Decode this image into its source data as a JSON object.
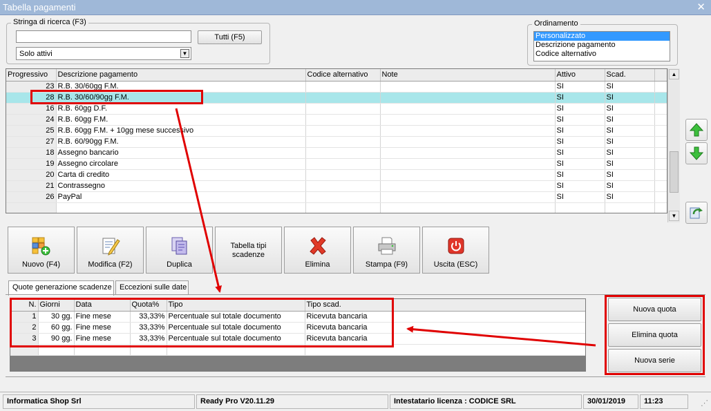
{
  "window": {
    "title": "Tabella pagamenti",
    "close_glyph": "✕"
  },
  "search": {
    "group_label": "Stringa di ricerca (F3)",
    "value": "",
    "all_button": "Tutti (F5)",
    "filter_value": "Solo attivi"
  },
  "ordering": {
    "group_label": "Ordinamento",
    "options": [
      "Personalizzato",
      "Descrizione pagamento",
      "Codice alternativo"
    ],
    "selected_index": 0
  },
  "payments_grid": {
    "columns": [
      "Progressivo",
      "Descrizione pagamento",
      "Codice alternativo",
      "Note",
      "Attivo",
      "Scad."
    ],
    "rows": [
      {
        "progressivo": "23",
        "descrizione": "R.B. 30/60gg F.M.",
        "codice": "",
        "note": "",
        "attivo": "SI",
        "scad": "SI",
        "selected": false
      },
      {
        "progressivo": "28",
        "descrizione": "R.B. 30/60/90gg F.M.",
        "codice": "",
        "note": "",
        "attivo": "SI",
        "scad": "SI",
        "selected": true
      },
      {
        "progressivo": "16",
        "descrizione": "R.B. 60gg D.F.",
        "codice": "",
        "note": "",
        "attivo": "SI",
        "scad": "SI",
        "selected": false
      },
      {
        "progressivo": "24",
        "descrizione": "R.B. 60gg F.M.",
        "codice": "",
        "note": "",
        "attivo": "SI",
        "scad": "SI",
        "selected": false
      },
      {
        "progressivo": "25",
        "descrizione": "R.B. 60gg F.M. + 10gg mese successivo",
        "codice": "",
        "note": "",
        "attivo": "SI",
        "scad": "SI",
        "selected": false
      },
      {
        "progressivo": "27",
        "descrizione": "R.B. 60/90gg F.M.",
        "codice": "",
        "note": "",
        "attivo": "SI",
        "scad": "SI",
        "selected": false
      },
      {
        "progressivo": "18",
        "descrizione": "Assegno bancario",
        "codice": "",
        "note": "",
        "attivo": "SI",
        "scad": "SI",
        "selected": false
      },
      {
        "progressivo": "19",
        "descrizione": "Assegno circolare",
        "codice": "",
        "note": "",
        "attivo": "SI",
        "scad": "SI",
        "selected": false
      },
      {
        "progressivo": "20",
        "descrizione": "Carta di credito",
        "codice": "",
        "note": "",
        "attivo": "SI",
        "scad": "SI",
        "selected": false
      },
      {
        "progressivo": "21",
        "descrizione": "Contrassegno",
        "codice": "",
        "note": "",
        "attivo": "SI",
        "scad": "SI",
        "selected": false
      },
      {
        "progressivo": "26",
        "descrizione": "PayPal",
        "codice": "",
        "note": "",
        "attivo": "SI",
        "scad": "SI",
        "selected": false
      }
    ]
  },
  "toolbar": {
    "new": "Nuovo (F4)",
    "edit": "Modifica (F2)",
    "duplicate": "Duplica",
    "types_line1": "Tabella tipi",
    "types_line2": "scadenze",
    "delete": "Elimina",
    "print": "Stampa (F9)",
    "exit": "Uscita (ESC)"
  },
  "tabs": [
    "Quote generazione scadenze",
    "Eccezioni sulle date"
  ],
  "quotes_grid": {
    "columns": [
      "N.",
      "Giorni",
      "Data",
      "Quota%",
      "Tipo",
      "Tipo scad."
    ],
    "rows": [
      {
        "n": "1",
        "giorni": "30 gg.",
        "data": "Fine mese",
        "quota": "33,33%",
        "tipo": "Percentuale sul totale documento",
        "tipo_scad": "Ricevuta bancaria"
      },
      {
        "n": "2",
        "giorni": "60 gg.",
        "data": "Fine mese",
        "quota": "33,33%",
        "tipo": "Percentuale sul totale documento",
        "tipo_scad": "Ricevuta bancaria"
      },
      {
        "n": "3",
        "giorni": "90 gg.",
        "data": "Fine mese",
        "quota": "33,33%",
        "tipo": "Percentuale sul totale documento",
        "tipo_scad": "Ricevuta bancaria"
      }
    ]
  },
  "quote_actions": {
    "new_quota": "Nuova quota",
    "delete_quota": "Elimina quota",
    "new_series": "Nuova serie"
  },
  "status": {
    "company": "Informatica Shop Srl",
    "version": "Ready Pro V20.11.29",
    "license": "Intestatario licenza : CODICE SRL",
    "date": "30/01/2019",
    "time": "11:23"
  },
  "colors": {
    "title_bar": "#9fb8d8",
    "selected_row": "#a8e6ea",
    "annotation_red": "#e00000",
    "listbox_selection": "#3399ff"
  }
}
